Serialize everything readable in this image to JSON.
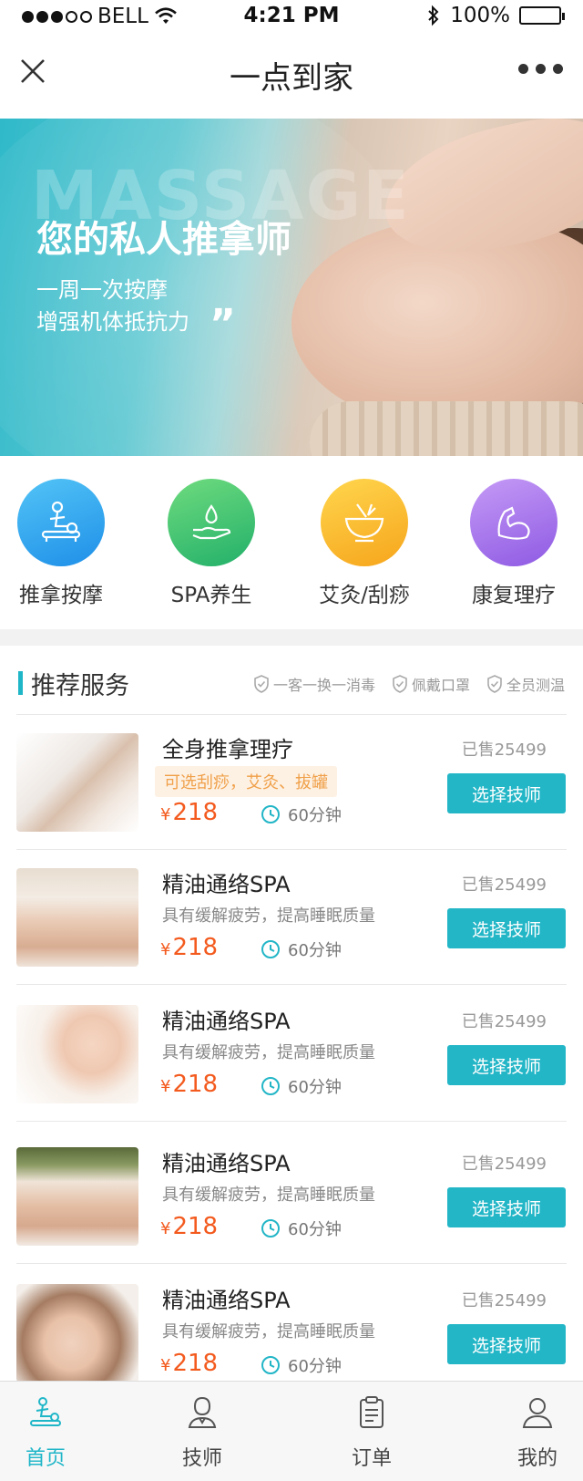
{
  "status_bar": {
    "carrier": "BELL",
    "time": "4:21 PM",
    "battery": "100%"
  },
  "navbar": {
    "title": "一点到家"
  },
  "banner": {
    "big_word": "MASSAGE",
    "headline": "您的私人推拿师",
    "line1": "一周一次按摩",
    "line2": "增强机体抵抗力",
    "pages": 3,
    "active_page": 3
  },
  "categories": [
    {
      "label": "推拿按摩",
      "color_from": "#53c4f6",
      "color_to": "#1e8fe8",
      "icon": "massage-icon"
    },
    {
      "label": "SPA养生",
      "color_from": "#6fdb7e",
      "color_to": "#22b06a",
      "icon": "spa-hand-icon"
    },
    {
      "label": "艾灸/刮痧",
      "color_from": "#ffd64d",
      "color_to": "#f6a51c",
      "icon": "mortar-icon"
    },
    {
      "label": "康复理疗",
      "color_from": "#c59af6",
      "color_to": "#8e5ae3",
      "icon": "muscle-arm-icon"
    }
  ],
  "section": {
    "title": "推荐服务",
    "badges": [
      "一客一换一消毒",
      "佩戴口罩",
      "全员测温"
    ]
  },
  "services": [
    {
      "title": "全身推拿理疗",
      "tag": "可选刮痧，艾灸、拔罐",
      "desc": "",
      "price": "218",
      "currency": "¥",
      "duration": "60分钟",
      "sold": "已售25499",
      "button": "选择技师"
    },
    {
      "title": "精油通络SPA",
      "tag": "",
      "desc": "具有缓解疲劳，提高睡眠质量",
      "price": "218",
      "currency": "¥",
      "duration": "60分钟",
      "sold": "已售25499",
      "button": "选择技师"
    },
    {
      "title": "精油通络SPA",
      "tag": "",
      "desc": "具有缓解疲劳，提高睡眠质量",
      "price": "218",
      "currency": "¥",
      "duration": "60分钟",
      "sold": "已售25499",
      "button": "选择技师"
    },
    {
      "title": "精油通络SPA",
      "tag": "",
      "desc": "具有缓解疲劳，提高睡眠质量",
      "price": "218",
      "currency": "¥",
      "duration": "60分钟",
      "sold": "已售25499",
      "button": "选择技师"
    },
    {
      "title": "精油通络SPA",
      "tag": "",
      "desc": "具有缓解疲劳，提高睡眠质量",
      "price": "218",
      "currency": "¥",
      "duration": "60分钟",
      "sold": "已售25499",
      "button": "选择技师"
    }
  ],
  "tabbar": {
    "items": [
      {
        "label": "首页",
        "icon": "home-massage-icon",
        "active": true
      },
      {
        "label": "技师",
        "icon": "therapist-icon",
        "active": false
      },
      {
        "label": "订单",
        "icon": "order-clipboard-icon",
        "active": false
      },
      {
        "label": "我的",
        "icon": "profile-icon",
        "active": false
      }
    ]
  },
  "colors": {
    "accent": "#1fb6c8",
    "price": "#f35a1e",
    "tag_text": "#f0a049",
    "tag_bg": "#fdf1e4"
  }
}
